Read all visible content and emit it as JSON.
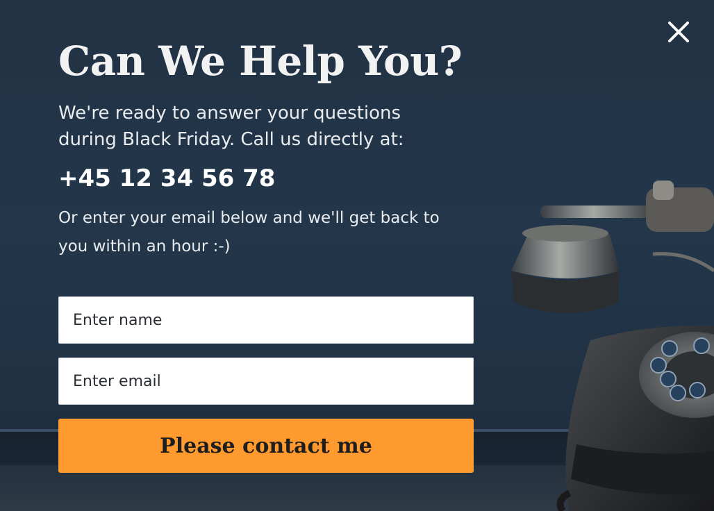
{
  "popup": {
    "title": "Can We Help You?",
    "lead_text": "We're ready to answer your questions during Black Friday. Call us directly at:",
    "phone_number": "+45 12 34 56 78",
    "sub_text": "Or enter your email below and we'll get back to you within an hour :-)"
  },
  "form": {
    "name_placeholder": "Enter name",
    "email_placeholder": "Enter email",
    "submit_label": "Please contact me"
  },
  "icons": {
    "close": "close-icon",
    "background_image": "rotary-telephone-image"
  },
  "colors": {
    "background": "#223244",
    "accent": "#ff9a2e",
    "title_text": "#f2f2f2",
    "input_background": "#ffffff"
  }
}
